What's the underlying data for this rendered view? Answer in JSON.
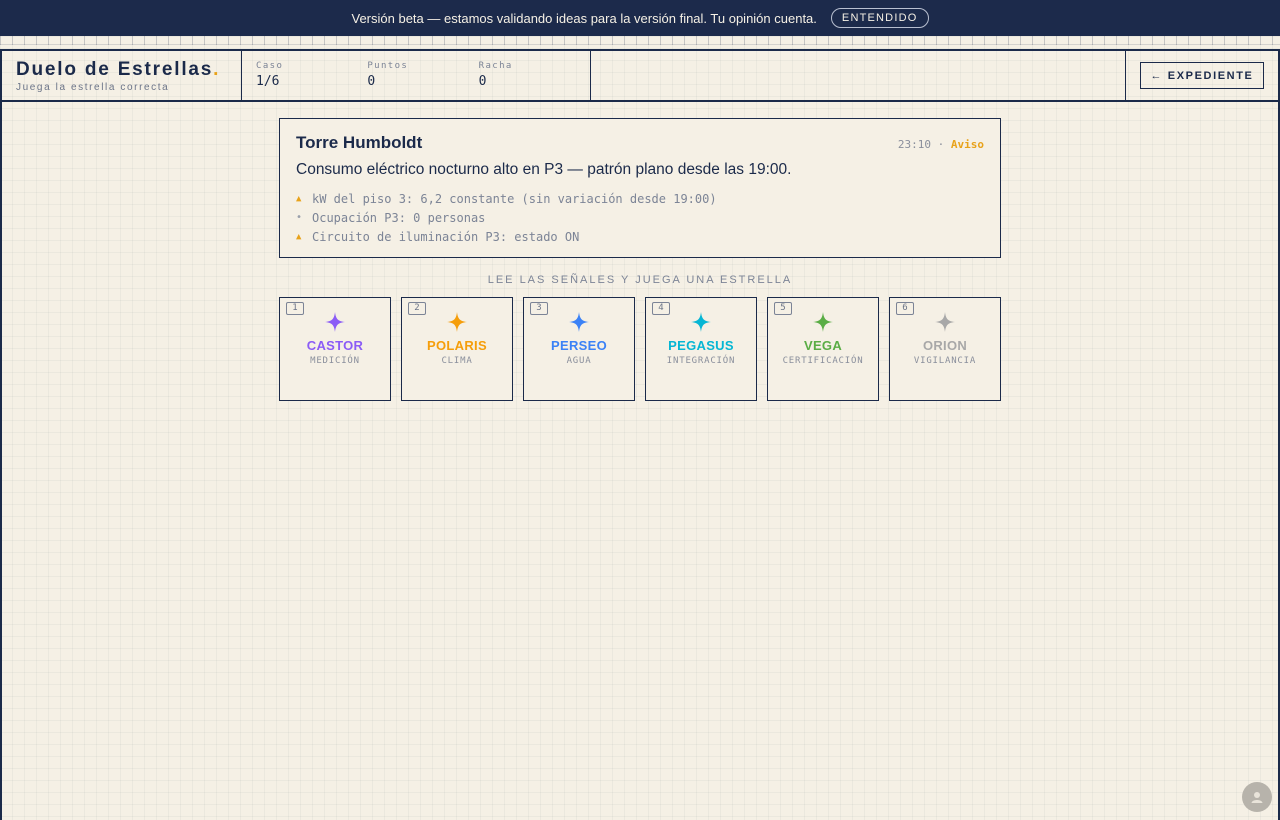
{
  "banner": {
    "message": "Versión beta — estamos validando ideas para la versión final. Tu opinión cuenta.",
    "button_label": "ENTENDIDO"
  },
  "header": {
    "title": "Duelo de Estrellas",
    "title_dot": ".",
    "subtitle": "Juega la estrella correcta",
    "stats": [
      {
        "label": "Caso",
        "value": "1/6"
      },
      {
        "label": "Puntos",
        "value": "0"
      },
      {
        "label": "Racha",
        "value": "0"
      }
    ],
    "back_button_label": "← EXPEDIENTE"
  },
  "case": {
    "title": "Torre Humboldt",
    "time": "23:10",
    "separator": "·",
    "level": "Aviso",
    "headline": "Consumo eléctrico nocturno alto en P3 — patrón plano desde las 19:00.",
    "signals": [
      {
        "icon": "warning-triangle-icon",
        "glyph": "▲",
        "text": "kW del piso 3: 6,2 constante (sin variación desde 19:00)"
      },
      {
        "icon": "neutral-dot-icon",
        "glyph": "•",
        "text": "Ocupación P3: 0 personas"
      },
      {
        "icon": "warning-triangle-icon",
        "glyph": "▲",
        "text": "Circuito de iluminación P3: estado ON"
      }
    ]
  },
  "instruction": "LEE LAS SEÑALES Y JUEGA UNA ESTRELLA",
  "cards": [
    {
      "num": "1",
      "name": "CASTOR",
      "category": "MEDICIÓN",
      "color": "#8b5cf6"
    },
    {
      "num": "2",
      "name": "POLARIS",
      "category": "CLIMA",
      "color": "#f59e0b"
    },
    {
      "num": "3",
      "name": "PERSEO",
      "category": "AGUA",
      "color": "#3b82f6"
    },
    {
      "num": "4",
      "name": "PEGASUS",
      "category": "INTEGRACIÓN",
      "color": "#06b6d4"
    },
    {
      "num": "5",
      "name": "VEGA",
      "category": "CERTIFICACIÓN",
      "color": "#5aad45"
    },
    {
      "num": "6",
      "name": "ORION",
      "category": "VIGILANCIA",
      "color": "#a8a8a8"
    }
  ],
  "colors": {
    "ink": "#1b2a4a",
    "paper": "#f5f0e5",
    "accent": "#e8a21a"
  }
}
